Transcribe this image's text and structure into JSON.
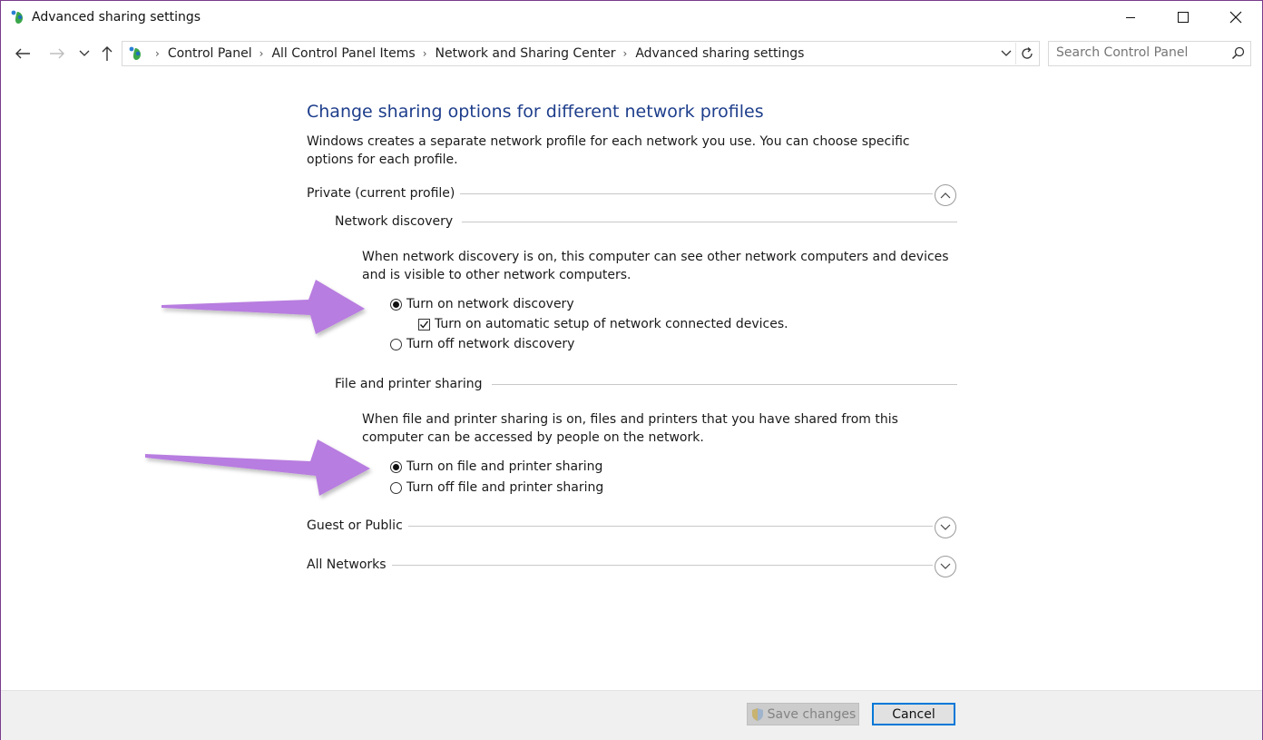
{
  "window": {
    "title": "Advanced sharing settings",
    "frame_color": "#7a3c8c"
  },
  "address_bar": {
    "breadcrumbs": [
      "Control Panel",
      "All Control Panel Items",
      "Network and Sharing Center",
      "Advanced sharing settings"
    ]
  },
  "search": {
    "placeholder": "Search Control Panel"
  },
  "main": {
    "heading": "Change sharing options for different network profiles",
    "intro": "Windows creates a separate network profile for each network you use. You can choose specific options for each profile.",
    "profiles": [
      {
        "label": "Private (current profile)",
        "expanded": true
      },
      {
        "label": "Guest or Public",
        "expanded": false
      },
      {
        "label": "All Networks",
        "expanded": false
      }
    ],
    "network_discovery": {
      "label": "Network discovery",
      "description": "When network discovery is on, this computer can see other network computers and devices and is visible to other network computers.",
      "option_on": "Turn on network discovery",
      "option_auto_setup": "Turn on automatic setup of network connected devices.",
      "option_off": "Turn off network discovery",
      "selected": "on",
      "auto_setup_checked": true
    },
    "file_printer_sharing": {
      "label": "File and printer sharing",
      "description": "When file and printer sharing is on, files and printers that you have shared from this computer can be accessed by people on the network.",
      "option_on": "Turn on file and printer sharing",
      "option_off": "Turn off file and printer sharing",
      "selected": "on"
    }
  },
  "footer": {
    "save_label": "Save changes",
    "cancel_label": "Cancel",
    "save_enabled": false
  },
  "colors": {
    "heading": "#1e3e8c",
    "annotation_arrow": "#b87de0",
    "accent": "#0078d7"
  },
  "icons": {
    "app": "network-center-icon",
    "back": "back-arrow-icon",
    "forward": "forward-arrow-icon",
    "recent": "chevron-down-icon",
    "up": "up-arrow-icon",
    "refresh": "refresh-icon",
    "search": "search-icon",
    "shield": "uac-shield-icon"
  }
}
